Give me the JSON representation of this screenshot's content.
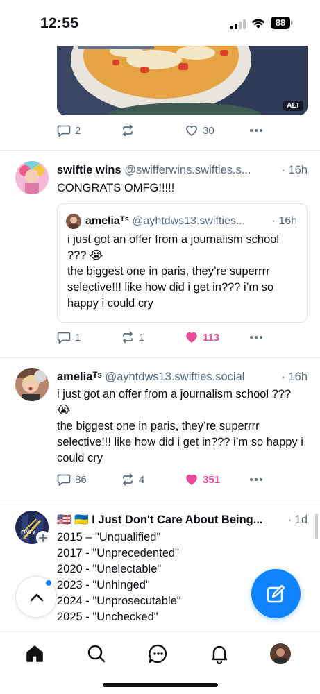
{
  "status_bar": {
    "time": "12:55",
    "battery": "88"
  },
  "posts": [
    {
      "image_alt_badge": "ALT",
      "replies": "2",
      "reposts": "",
      "likes": "30"
    },
    {
      "display_name": "swiftie wins",
      "handle": "@swifferwins.swifties.s...",
      "time": "· 16h",
      "text": "CONGRATS OMFG!!!!!",
      "quote": {
        "display_name": "ameliaᵀˢ",
        "handle": "@ayhtdws13.swifties...",
        "time": "· 16h",
        "text": " i just got an offer from a journalism school ??? 😭\nthe biggest one in paris, they’re superrrr selective!!! like how did i get in??? i’m so happy i could cry"
      },
      "replies": "1",
      "reposts": "1",
      "likes": "113"
    },
    {
      "display_name": "ameliaᵀˢ",
      "handle": "@ayhtdws13.swifties.social",
      "time": "· 16h",
      "text": " i just got an offer from a journalism school ??? 😭\nthe biggest one in paris, they’re superrrr selective!!! like how did i get in??? i’m so happy i could cry",
      "replies": "86",
      "reposts": "4",
      "likes": "351"
    },
    {
      "display_name": "🇺🇸 🇺🇦 I Just Don't Care About Being...",
      "time": "· 1d",
      "text": "2015 – \"Unqualified\"\n2017 - \"Unprecedented\"\n2020 - \"Unelectable\"\n2023 - \"Unhinged\"\n2024 - \"Unprosecutable\"\n2025 - \"Unchecked\""
    }
  ],
  "colors": {
    "accent": "#1083fe",
    "like": "#ec4899",
    "muted": "#5b6b7d"
  },
  "tabs": [
    "home-icon",
    "search-icon",
    "chat-icon",
    "bell-icon",
    "profile-avatar"
  ]
}
